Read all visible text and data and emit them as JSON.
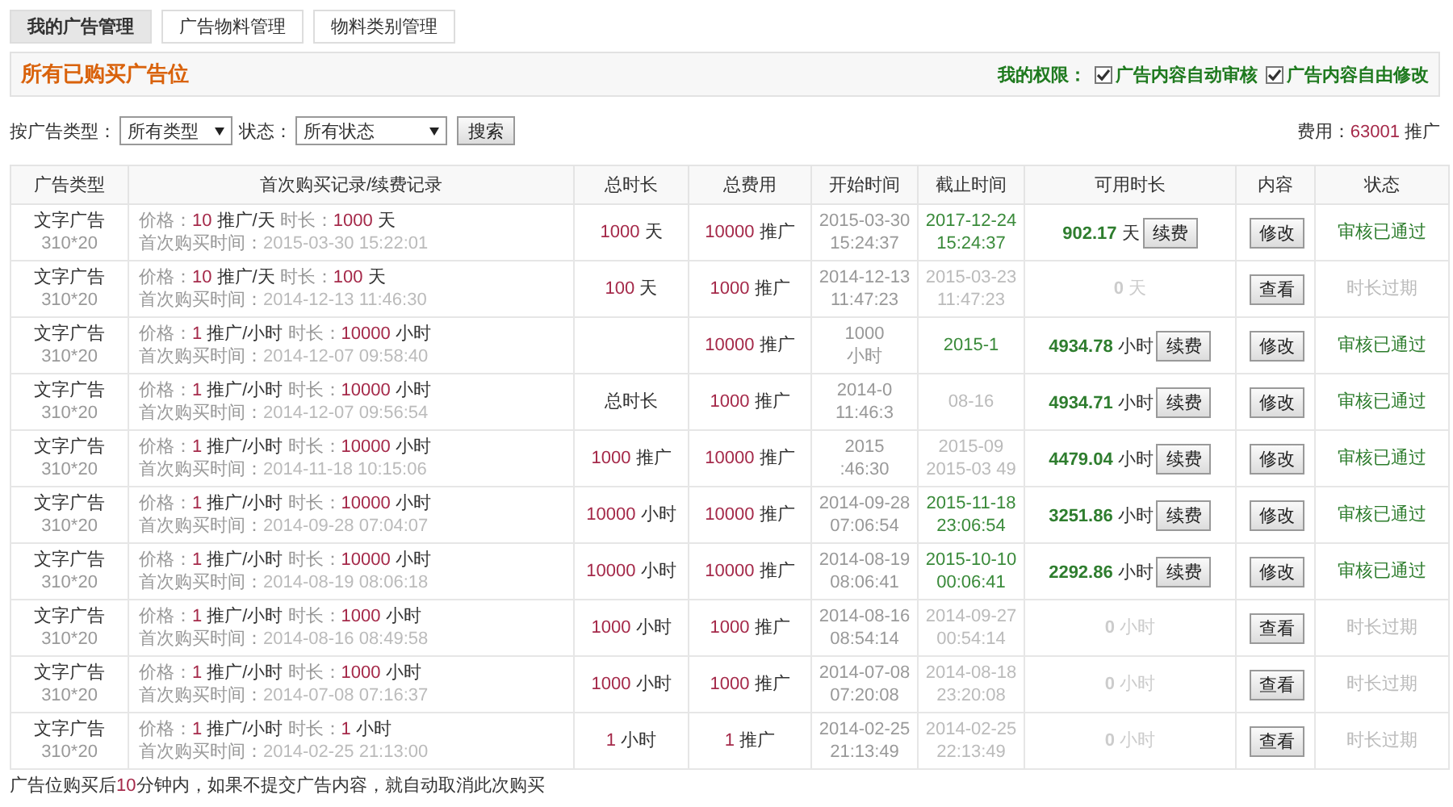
{
  "tabs": [
    {
      "label": "我的广告管理",
      "selected": true
    },
    {
      "label": "广告物料管理",
      "selected": false
    },
    {
      "label": "物料类别管理",
      "selected": false
    }
  ],
  "header": {
    "title": "所有已购买广告位",
    "permissions_label": "我的权限：",
    "permissions": [
      {
        "label": "广告内容自动审核",
        "checked": true
      },
      {
        "label": "广告内容自由修改",
        "checked": true
      }
    ]
  },
  "filters": {
    "type_label": "按广告类型：",
    "type_value": "所有类型",
    "status_label": "状态：",
    "status_value": "所有状态",
    "search_button": "搜索",
    "fee_label": "费用：",
    "fee_value": "63001",
    "fee_unit": "推广"
  },
  "table": {
    "columns": [
      "广告类型",
      "首次购买记录/续费记录",
      "总时长",
      "总费用",
      "开始时间",
      "截止时间",
      "可用时长",
      "内容",
      "状态"
    ],
    "rows": [
      {
        "type": "文字广告",
        "size": "310*20",
        "price_label": "价格：",
        "price": "10",
        "price_unit": "推广/天",
        "duration_label": "时长：",
        "duration": "1000",
        "duration_unit": "天",
        "purchase_label": "首次购买时间：",
        "purchase_time": "2015-03-30 15:22:01",
        "total_duration": [
          "1000",
          "天"
        ],
        "total_fee": [
          "10000",
          "推广"
        ],
        "start": [
          "2015-03-30",
          "15:24:37"
        ],
        "end": [
          "2017-12-24",
          "15:24:37"
        ],
        "active": true,
        "remaining": [
          "902.17",
          "天"
        ],
        "renew": "续费",
        "content_button": "修改",
        "status": {
          "text": "审核已通过",
          "kind": "passed"
        }
      },
      {
        "type": "文字广告",
        "size": "310*20",
        "price_label": "价格：",
        "price": "10",
        "price_unit": "推广/天",
        "duration_label": "时长：",
        "duration": "100",
        "duration_unit": "天",
        "purchase_label": "首次购买时间：",
        "purchase_time": "2014-12-13 11:46:30",
        "total_duration": [
          "100",
          "天"
        ],
        "total_fee": [
          "1000",
          "推广"
        ],
        "start": [
          "2014-12-13",
          "11:47:23"
        ],
        "end": [
          "2015-03-23",
          "11:47:23"
        ],
        "active": false,
        "remaining": [
          "0",
          "天"
        ],
        "content_button": "查看",
        "status": {
          "text": "时长过期",
          "kind": "expired"
        }
      },
      {
        "type": "文字广告",
        "size": "310*20",
        "price_label": "价格：",
        "price": "1",
        "price_unit": "推广/小时",
        "duration_label": "时长：",
        "duration": "10000",
        "duration_unit": "小时",
        "purchase_label": "首次购买时间：",
        "purchase_time": "2014-12-07 09:58:40",
        "total_fee": [
          "10000",
          "推广"
        ],
        "start": [
          "1000",
          "小时"
        ],
        "end": [
          "2015-1"
        ],
        "active": true,
        "remaining": [
          "4934.78",
          "小时"
        ],
        "renew": "续费",
        "content_button": "修改",
        "status": {
          "text": "审核已通过",
          "kind": "passed"
        }
      },
      {
        "type": "文字广告",
        "size": "310*20",
        "price_label": "价格：",
        "price": "1",
        "price_unit": "推广/小时",
        "duration_label": "时长：",
        "duration": "10000",
        "duration_unit": "小时",
        "purchase_label": "首次购买时间：",
        "purchase_time": "2014-12-07 09:56:54",
        "total_duration": [
          "总时长"
        ],
        "total_fee": [
          "1000",
          "推广"
        ],
        "start": [
          "2014-0",
          "11:46:3"
        ],
        "end": [
          "08-16"
        ],
        "active": false,
        "remaining": [
          "4934.71",
          "小时"
        ],
        "renew": "续费",
        "content_button": "修改",
        "status": {
          "text": "审核已通过",
          "kind": "passed"
        }
      },
      {
        "type": "文字广告",
        "size": "310*20",
        "price_label": "价格：",
        "price": "1",
        "price_unit": "推广/小时",
        "duration_label": "时长：",
        "duration": "10000",
        "duration_unit": "小时",
        "purchase_label": "首次购买时间：",
        "purchase_time": "2014-11-18 10:15:06",
        "total_duration": [
          "1000",
          "推广"
        ],
        "total_fee": [
          "10000",
          "推广"
        ],
        "start": [
          "2015",
          ":46:30"
        ],
        "end": [
          "2015-09",
          "2015-03 49"
        ],
        "active": false,
        "remaining": [
          "4479.04",
          "小时"
        ],
        "renew": "续费",
        "content_button": "修改",
        "status": {
          "text": "审核已通过",
          "kind": "passed"
        }
      },
      {
        "type": "文字广告",
        "size": "310*20",
        "price_label": "价格：",
        "price": "1",
        "price_unit": "推广/小时",
        "duration_label": "时长：",
        "duration": "10000",
        "duration_unit": "小时",
        "purchase_label": "首次购买时间：",
        "purchase_time": "2014-09-28 07:04:07",
        "total_duration": [
          "10000",
          "小时"
        ],
        "total_fee": [
          "10000",
          "推广"
        ],
        "start": [
          "2014-09-28",
          "07:06:54"
        ],
        "end": [
          "2015-11-18",
          "23:06:54"
        ],
        "active": true,
        "remaining": [
          "3251.86",
          "小时"
        ],
        "renew": "续费",
        "content_button": "修改",
        "status": {
          "text": "审核已通过",
          "kind": "passed"
        }
      },
      {
        "type": "文字广告",
        "size": "310*20",
        "price_label": "价格：",
        "price": "1",
        "price_unit": "推广/小时",
        "duration_label": "时长：",
        "duration": "10000",
        "duration_unit": "小时",
        "purchase_label": "首次购买时间：",
        "purchase_time": "2014-08-19 08:06:18",
        "total_duration": [
          "10000",
          "小时"
        ],
        "total_fee": [
          "10000",
          "推广"
        ],
        "start": [
          "2014-08-19",
          "08:06:41"
        ],
        "end": [
          "2015-10-10",
          "00:06:41"
        ],
        "active": true,
        "remaining": [
          "2292.86",
          "小时"
        ],
        "renew": "续费",
        "content_button": "修改",
        "status": {
          "text": "审核已通过",
          "kind": "passed"
        }
      },
      {
        "type": "文字广告",
        "size": "310*20",
        "price_label": "价格：",
        "price": "1",
        "price_unit": "推广/小时",
        "duration_label": "时长：",
        "duration": "1000",
        "duration_unit": "小时",
        "purchase_label": "首次购买时间：",
        "purchase_time": "2014-08-16 08:49:58",
        "total_duration": [
          "1000",
          "小时"
        ],
        "total_fee": [
          "1000",
          "推广"
        ],
        "start": [
          "2014-08-16",
          "08:54:14"
        ],
        "end": [
          "2014-09-27",
          "00:54:14"
        ],
        "active": false,
        "remaining": [
          "0",
          "小时"
        ],
        "content_button": "查看",
        "status": {
          "text": "时长过期",
          "kind": "expired"
        }
      },
      {
        "type": "文字广告",
        "size": "310*20",
        "price_label": "价格：",
        "price": "1",
        "price_unit": "推广/小时",
        "duration_label": "时长：",
        "duration": "1000",
        "duration_unit": "小时",
        "purchase_label": "首次购买时间：",
        "purchase_time": "2014-07-08 07:16:37",
        "total_duration": [
          "1000",
          "小时"
        ],
        "total_fee": [
          "1000",
          "推广"
        ],
        "start": [
          "2014-07-08",
          "07:20:08"
        ],
        "end": [
          "2014-08-18",
          "23:20:08"
        ],
        "active": false,
        "remaining": [
          "0",
          "小时"
        ],
        "content_button": "查看",
        "status": {
          "text": "时长过期",
          "kind": "expired"
        }
      },
      {
        "type": "文字广告",
        "size": "310*20",
        "price_label": "价格：",
        "price": "1",
        "price_unit": "推广/小时",
        "duration_label": "时长：",
        "duration": "1",
        "duration_unit": "小时",
        "purchase_label": "首次购买时间：",
        "purchase_time": "2014-02-25 21:13:00",
        "total_duration": [
          "1",
          "小时"
        ],
        "total_fee": [
          "1",
          "推广"
        ],
        "start": [
          "2014-02-25",
          "21:13:49"
        ],
        "end": [
          "2014-02-25",
          "22:13:49"
        ],
        "active": false,
        "remaining": [
          "0",
          "小时"
        ],
        "content_button": "查看",
        "status": {
          "text": "时长过期",
          "kind": "expired"
        }
      }
    ]
  },
  "note": {
    "before": "广告位购买后",
    "highlight": "10",
    "after": "分钟内，如果不提交广告内容，就自动取消此次购买"
  }
}
